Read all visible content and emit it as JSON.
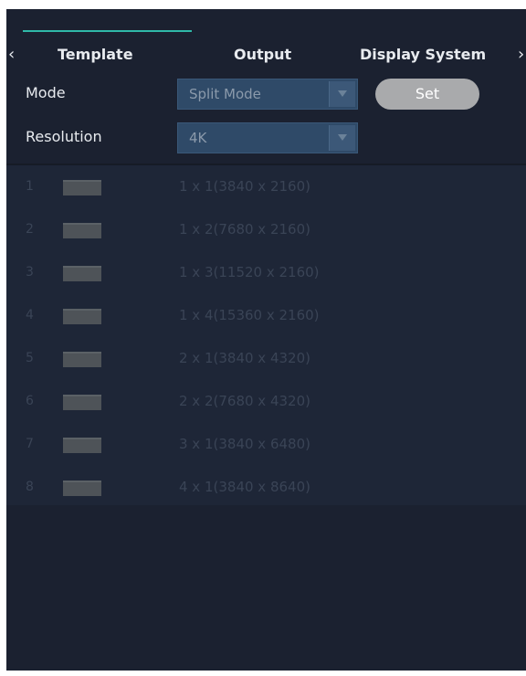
{
  "tabs": {
    "items": [
      {
        "label": "Template",
        "active": true
      },
      {
        "label": "Output",
        "active": false
      },
      {
        "label": "Display System",
        "active": false
      }
    ],
    "accent_color": "#2fb9a8"
  },
  "form": {
    "mode_label": "Mode",
    "mode_value": "Split Mode",
    "resolution_label": "Resolution",
    "resolution_value": "4K",
    "set_label": "Set"
  },
  "templates": [
    {
      "index": "1",
      "desc": "1 x 1(3840 x 2160)"
    },
    {
      "index": "2",
      "desc": "1 x 2(7680 x 2160)"
    },
    {
      "index": "3",
      "desc": "1 x 3(11520 x 2160)"
    },
    {
      "index": "4",
      "desc": "1 x 4(15360 x 2160)"
    },
    {
      "index": "5",
      "desc": "2 x 1(3840 x 4320)"
    },
    {
      "index": "6",
      "desc": "2 x 2(7680 x 4320)"
    },
    {
      "index": "7",
      "desc": "3 x 1(3840 x 6480)"
    },
    {
      "index": "8",
      "desc": "4 x 1(3840 x 8640)"
    }
  ]
}
